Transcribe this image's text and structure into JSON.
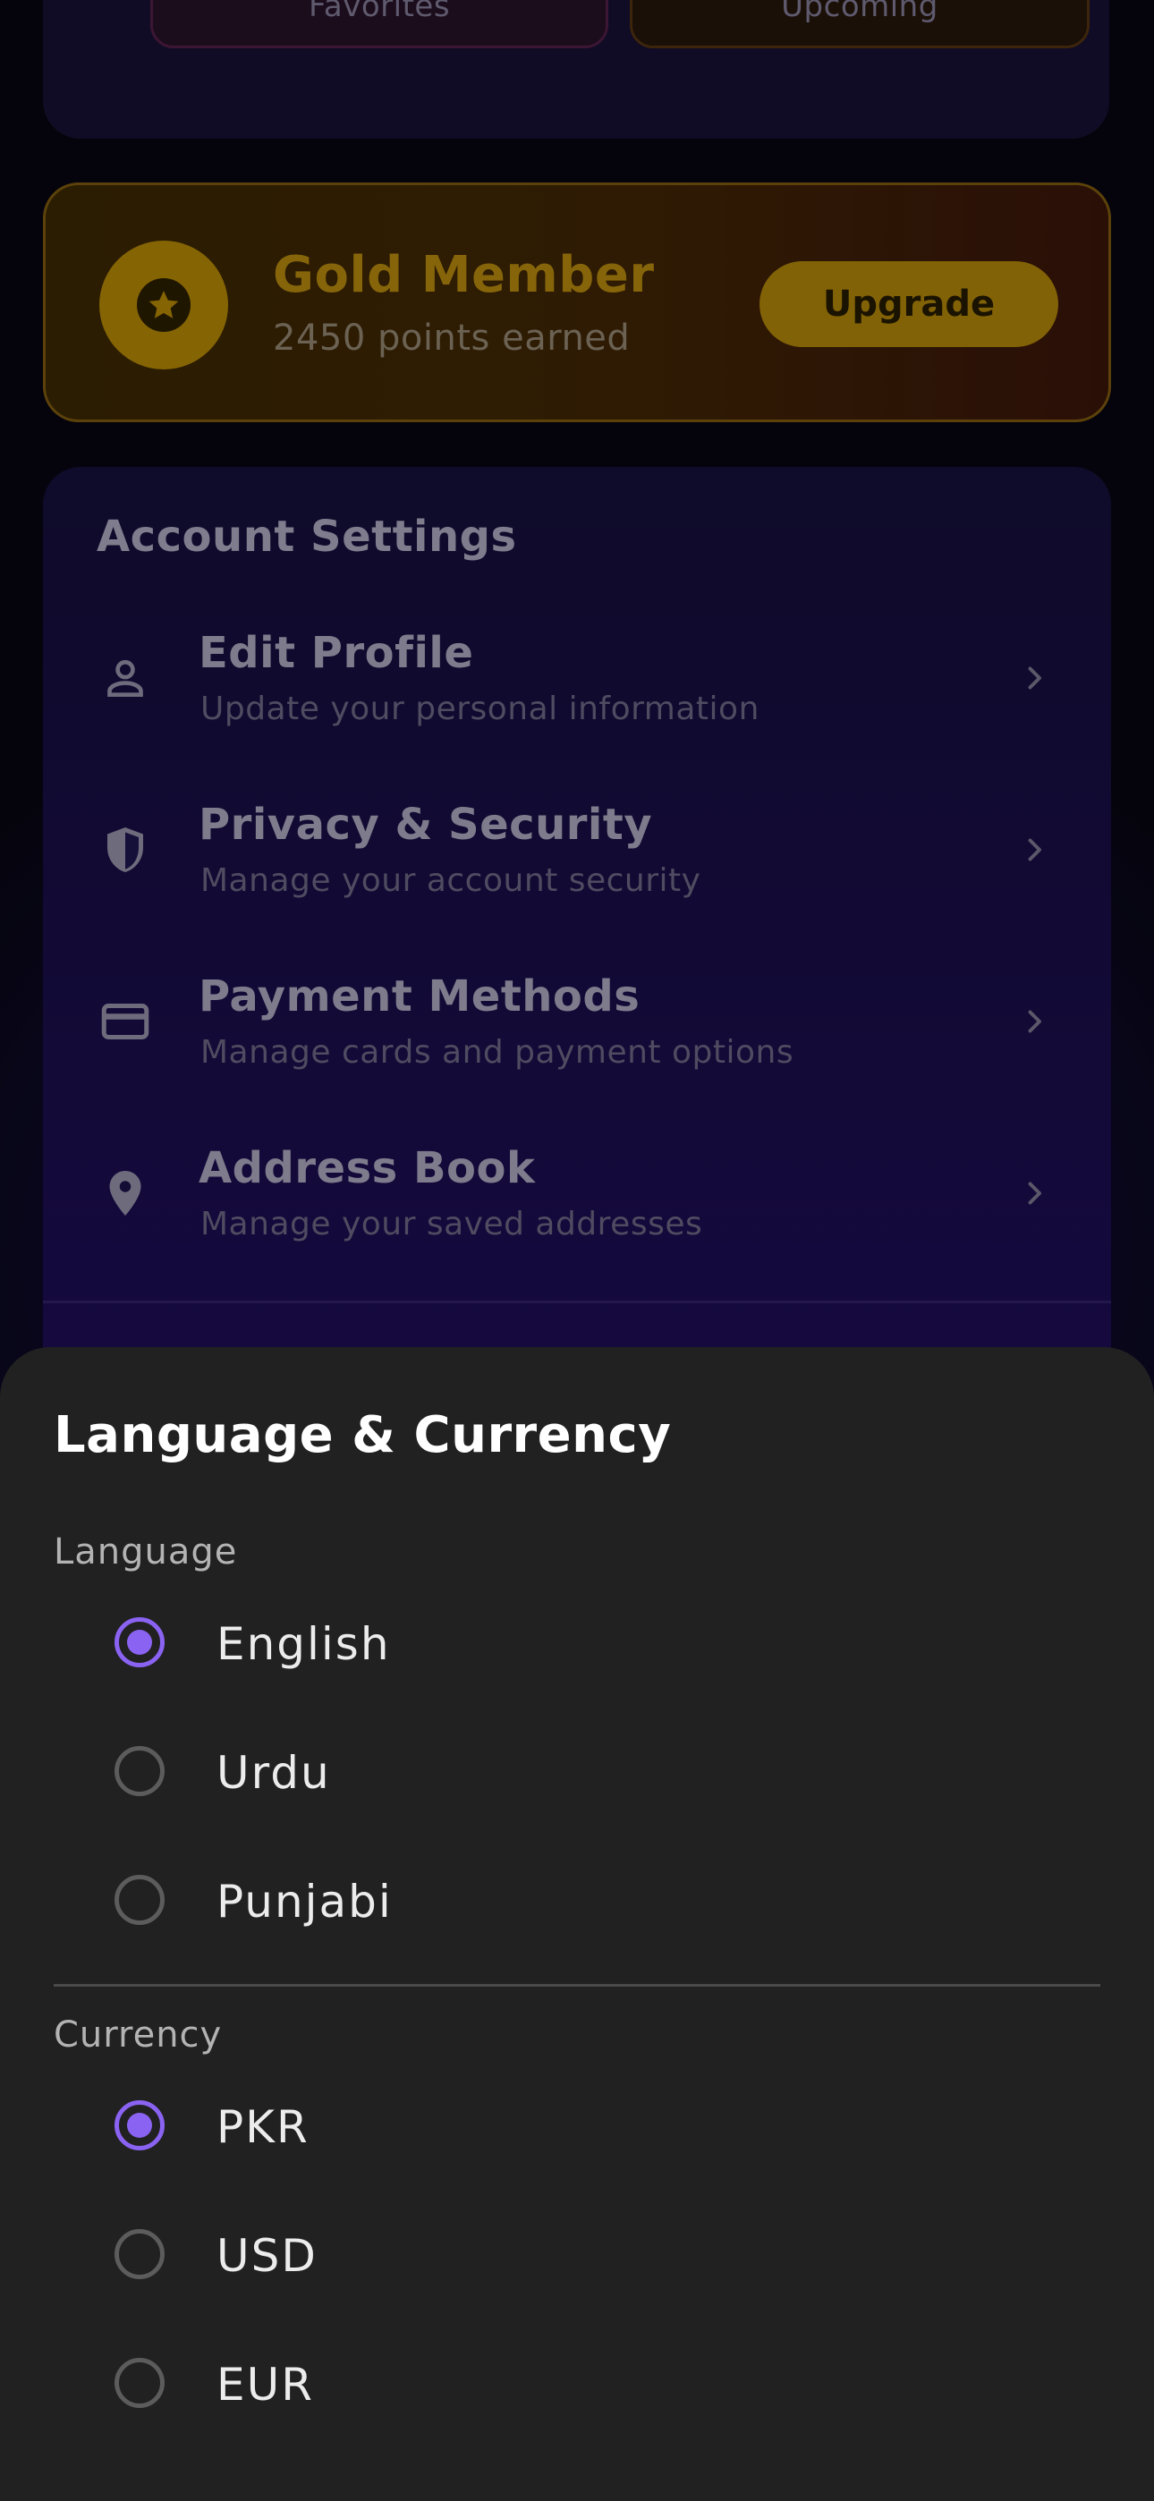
{
  "quick_links": {
    "favorites_label": "Favorites",
    "upcoming_label": "Upcoming"
  },
  "membership": {
    "title": "Gold Member",
    "points_text": "2450 points earned",
    "upgrade_label": "Upgrade",
    "accent_color": "#86650a"
  },
  "account_settings": {
    "title": "Account Settings",
    "items": [
      {
        "icon": "person-icon",
        "label": "Edit Profile",
        "description": "Update your personal information"
      },
      {
        "icon": "shield-icon",
        "label": "Privacy & Security",
        "description": "Manage your account security"
      },
      {
        "icon": "credit-card-icon",
        "label": "Payment Methods",
        "description": "Manage cards and payment options"
      },
      {
        "icon": "location-pin-icon",
        "label": "Address Book",
        "description": "Manage your saved addresses"
      }
    ]
  },
  "sheet": {
    "title": "Language & Currency",
    "language": {
      "label": "Language",
      "options": [
        {
          "label": "English",
          "selected": true
        },
        {
          "label": "Urdu",
          "selected": false
        },
        {
          "label": "Punjabi",
          "selected": false
        }
      ]
    },
    "currency": {
      "label": "Currency",
      "options": [
        {
          "label": "PKR",
          "selected": true
        },
        {
          "label": "USD",
          "selected": false
        },
        {
          "label": "EUR",
          "selected": false
        }
      ]
    },
    "accent_color": "#8a63f2"
  }
}
